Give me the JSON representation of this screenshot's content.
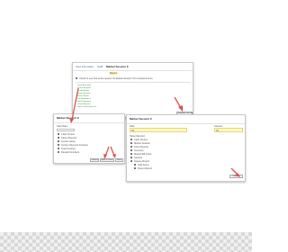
{
  "screenshot1": {
    "breadcrumb_1": "Issue Information",
    "breadcrumb_2": "QA/B",
    "breadcrumb_3": "Market Session II",
    "tab": "Report",
    "checkbox_text": "Check to see that entire quarter for Market Session XII completed entry",
    "list_items": [
      "Cash Received",
      "Check Register",
      "Credit Report",
      "Scope Reports",
      "Stock Sheets",
      "Tax Remittance",
      "Rent Payments",
      "Check Balance",
      "Sales Transaction.csv"
    ],
    "button": "Complete Session"
  },
  "screenshot2": {
    "title": "Market Session II",
    "fields": [
      "Start Date",
      "Cash Source",
      "Parent Reports",
      "Invoice Notes",
      "Invoice Payment Inclusive",
      "Total Invoices",
      "Receipt Numbers"
    ],
    "buttons": [
      "Cancel",
      "Save & Close",
      "Save"
    ]
  },
  "screenshot3": {
    "title": "Market Session II",
    "label_left": "Date",
    "label_right": "Session",
    "value_left": "03",
    "value_right": "03",
    "section_label": "Parent Record",
    "options": [
      "Cash Source",
      "Market Session",
      "Price Reports",
      "Inventory",
      "Market Bill Costs",
      "Session",
      "Spaces Report",
      "Sold Items",
      "Parent Report"
    ],
    "button": "Save All"
  },
  "colors": {
    "arrow": "#d9534f",
    "highlight": "#fff7c2"
  }
}
